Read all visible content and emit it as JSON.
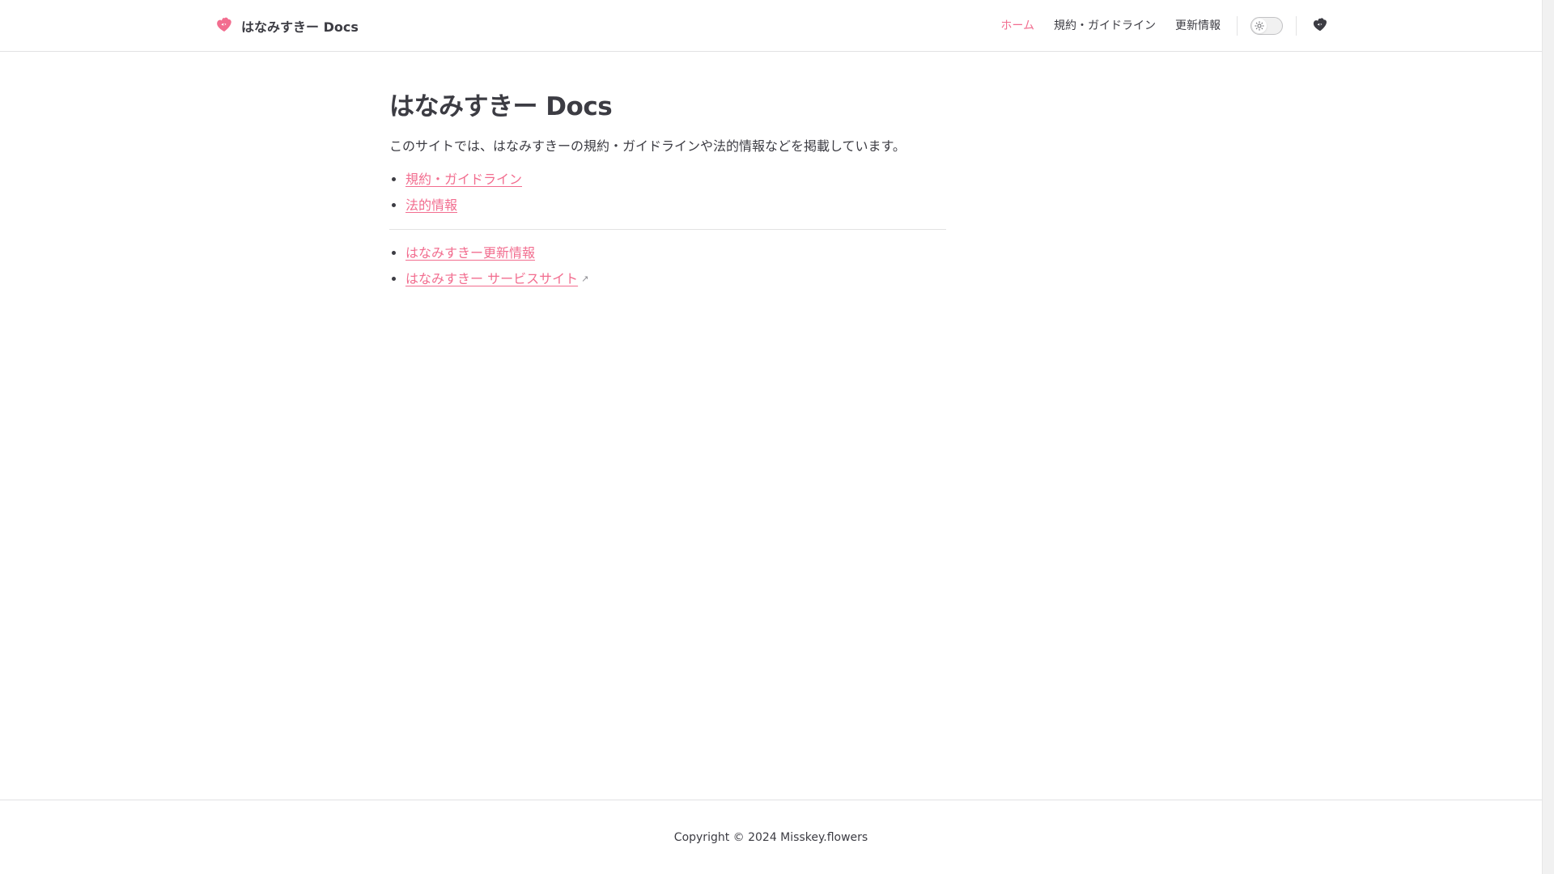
{
  "site": {
    "title": "はなみすきー Docs",
    "logo_icon": "flower-icon"
  },
  "nav": {
    "items": [
      {
        "label": "ホーム",
        "active": true
      },
      {
        "label": "規約・ガイドライン",
        "active": false
      },
      {
        "label": "更新情報",
        "active": false
      }
    ],
    "appearance_icon": "sun-icon",
    "social_icon": "misskey-icon"
  },
  "main": {
    "heading": "はなみすきー Docs",
    "lead": "このサイトでは、はなみすきーの規約・ガイドラインや法的情報などを掲載しています。",
    "links_primary": [
      {
        "label": "規約・ガイドライン"
      },
      {
        "label": "法的情報"
      }
    ],
    "links_secondary": [
      {
        "label": "はなみすきー更新情報",
        "external": false
      },
      {
        "label": "はなみすきー サービスサイト",
        "external": true,
        "ext_glyph": "↗"
      }
    ]
  },
  "footer": {
    "copyright": "Copyright © 2024 Misskey.flowers"
  },
  "colors": {
    "accent": "#f26d8f",
    "text": "#3c3c43",
    "border": "#e2e2e3"
  }
}
